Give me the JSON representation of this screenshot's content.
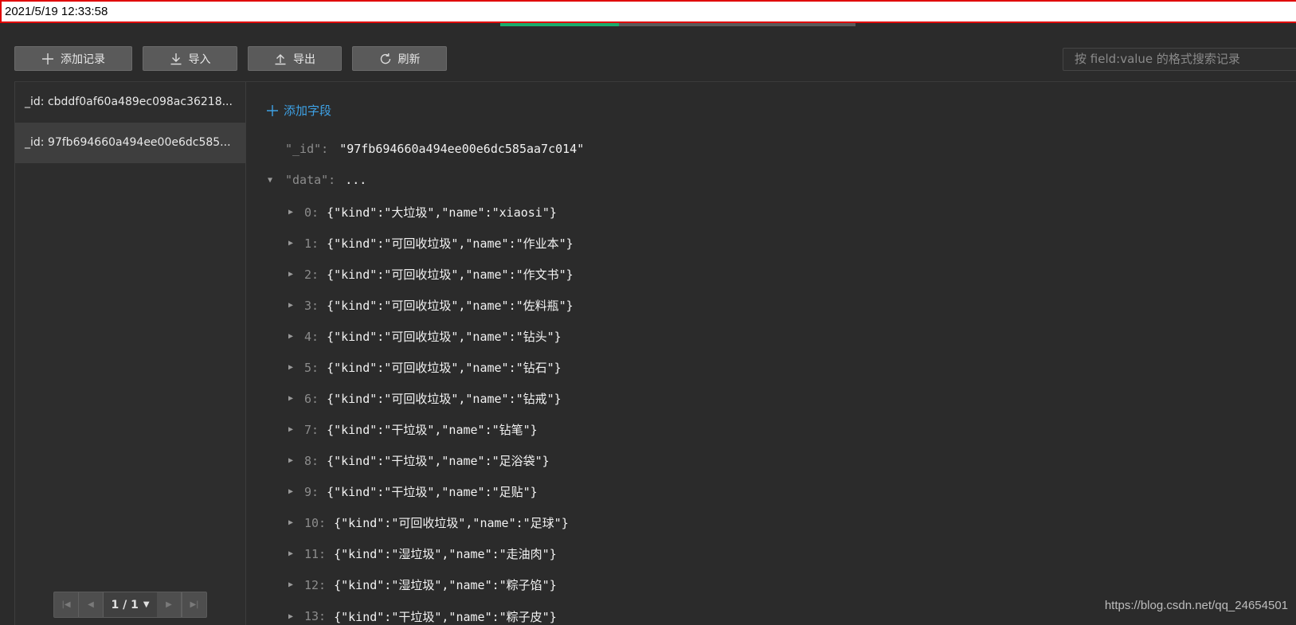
{
  "timestamp": "2021/5/19 12:33:58",
  "toolbar": {
    "add_record": "添加记录",
    "import": "导入",
    "export": "导出",
    "refresh": "刷新"
  },
  "search": {
    "placeholder": "按 field:value 的格式搜索记录"
  },
  "records": [
    {
      "label": "_id: cbddf0af60a489ec098ac36218..."
    },
    {
      "label": "_id: 97fb694660a494ee00e6dc585..."
    }
  ],
  "pager": {
    "page": "1 / 1"
  },
  "detail": {
    "add_field": "添加字段",
    "id_key": "\"_id\":",
    "id_value": "\"97fb694660a494ee00e6dc585aa7c014\"",
    "data_key": "\"data\":",
    "data_value": "...",
    "items": [
      {
        "idx": "0:",
        "value": "{\"kind\":\"大垃圾\",\"name\":\"xiaosi\"}"
      },
      {
        "idx": "1:",
        "value": "{\"kind\":\"可回收垃圾\",\"name\":\"作业本\"}"
      },
      {
        "idx": "2:",
        "value": "{\"kind\":\"可回收垃圾\",\"name\":\"作文书\"}"
      },
      {
        "idx": "3:",
        "value": "{\"kind\":\"可回收垃圾\",\"name\":\"佐料瓶\"}"
      },
      {
        "idx": "4:",
        "value": "{\"kind\":\"可回收垃圾\",\"name\":\"钻头\"}"
      },
      {
        "idx": "5:",
        "value": "{\"kind\":\"可回收垃圾\",\"name\":\"钻石\"}"
      },
      {
        "idx": "6:",
        "value": "{\"kind\":\"可回收垃圾\",\"name\":\"钻戒\"}"
      },
      {
        "idx": "7:",
        "value": "{\"kind\":\"干垃圾\",\"name\":\"钻笔\"}"
      },
      {
        "idx": "8:",
        "value": "{\"kind\":\"干垃圾\",\"name\":\"足浴袋\"}"
      },
      {
        "idx": "9:",
        "value": "{\"kind\":\"干垃圾\",\"name\":\"足贴\"}"
      },
      {
        "idx": "10:",
        "value": "{\"kind\":\"可回收垃圾\",\"name\":\"足球\"}"
      },
      {
        "idx": "11:",
        "value": "{\"kind\":\"湿垃圾\",\"name\":\"走油肉\"}"
      },
      {
        "idx": "12:",
        "value": "{\"kind\":\"湿垃圾\",\"name\":\"粽子馅\"}"
      },
      {
        "idx": "13:",
        "value": "{\"kind\":\"干垃圾\",\"name\":\"粽子皮\"}"
      }
    ]
  },
  "watermark": "https://blog.csdn.net/qq_24654501",
  "colors": {
    "accent_green": "#1aad6d",
    "link_blue": "#3ea1e5",
    "background": "#2b2b2b"
  }
}
